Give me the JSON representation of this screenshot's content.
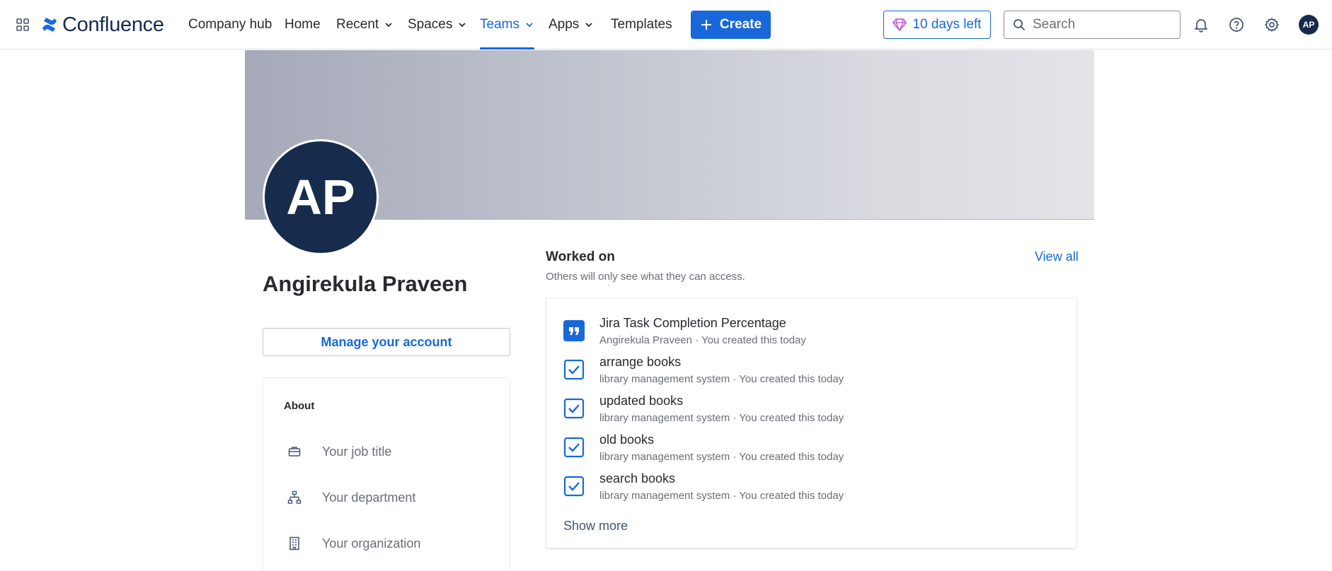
{
  "app": {
    "name": "Confluence",
    "brand_color": "#1868db"
  },
  "nav": {
    "items": [
      {
        "label": "Company hub",
        "dropdown": false
      },
      {
        "label": "Home",
        "dropdown": false
      },
      {
        "label": "Recent",
        "dropdown": true
      },
      {
        "label": "Spaces",
        "dropdown": true
      },
      {
        "label": "Teams",
        "dropdown": true,
        "active": true
      },
      {
        "label": "Apps",
        "dropdown": true
      },
      {
        "label": "Templates",
        "dropdown": false
      }
    ],
    "create_label": "Create",
    "trial_label": "10 days left",
    "search_placeholder": "Search",
    "avatar_initials": "AP"
  },
  "profile": {
    "initials": "AP",
    "name": "Angirekula Praveen",
    "manage_label": "Manage your account",
    "about": {
      "title": "About",
      "fields": [
        {
          "icon": "briefcase-icon",
          "placeholder": "Your job title"
        },
        {
          "icon": "org-chart-icon",
          "placeholder": "Your department"
        },
        {
          "icon": "building-icon",
          "placeholder": "Your organization"
        }
      ]
    }
  },
  "worked_on": {
    "title": "Worked on",
    "subtitle": "Others will only see what they can access.",
    "view_all_label": "View all",
    "items": [
      {
        "type": "quote",
        "icon": "quote-icon",
        "title": "Jira Task Completion Percentage",
        "meta": "Angirekula Praveen · You created this today"
      },
      {
        "type": "task",
        "icon": "checkbox-icon",
        "title": "arrange books",
        "meta": "library management system · You created this today"
      },
      {
        "type": "task",
        "icon": "checkbox-icon",
        "title": "updated books",
        "meta": "library management system · You created this today"
      },
      {
        "type": "task",
        "icon": "checkbox-icon",
        "title": "old books",
        "meta": "library management system · You created this today"
      },
      {
        "type": "task",
        "icon": "checkbox-icon",
        "title": "search books",
        "meta": "library management system · You created this today"
      }
    ],
    "show_more_label": "Show more"
  }
}
